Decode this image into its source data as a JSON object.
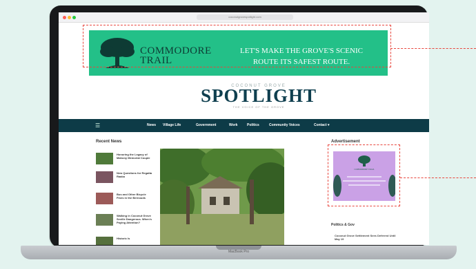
{
  "browser": {
    "url": "coconutgrovespotlight.com"
  },
  "laptop": {
    "label": "MacBook Pro"
  },
  "top_banner": {
    "brand_line1": "COMMODORE",
    "brand_line2": "TRAIL",
    "slogan_line1": "LET'S MAKE THE GROVE'S SCENIC",
    "slogan_line2": "ROUTE ITS SAFEST ROUTE."
  },
  "site": {
    "logo_small": "COCONUT GROVE",
    "logo": "SPOTLIGHT",
    "tagline": "THE VOICE OF THE GROVE"
  },
  "nav": {
    "items": [
      "News",
      "Village Life",
      "Government",
      "Work",
      "Politics",
      "Community Voices",
      "Contact ▾"
    ]
  },
  "recent": {
    "heading": "Recent News",
    "items": [
      {
        "title": "Honoring the Legacy of Mahony Memorial Couple"
      },
      {
        "title": "New Questions for Regatta Raabo"
      },
      {
        "title": "Bus and Other Bicycle Fines in the Bernouds"
      },
      {
        "title": "Walking in Coconut Grove Seville Dangerous. When's Paying Attention?"
      },
      {
        "title": "Historic Is"
      }
    ]
  },
  "sidebar": {
    "ad_heading": "Advertisement",
    "ad_brand": "COMMODORE TRAIL",
    "politics_heading": "Politics & Gov",
    "politics_item": "Coconut Grove Settlement Sees Deferred Until May 19"
  },
  "colors": {
    "banner_green": "#23c088",
    "nav_bg": "#0d3b47",
    "ad_purple": "#caa1e6",
    "highlight": "#e8453c"
  }
}
